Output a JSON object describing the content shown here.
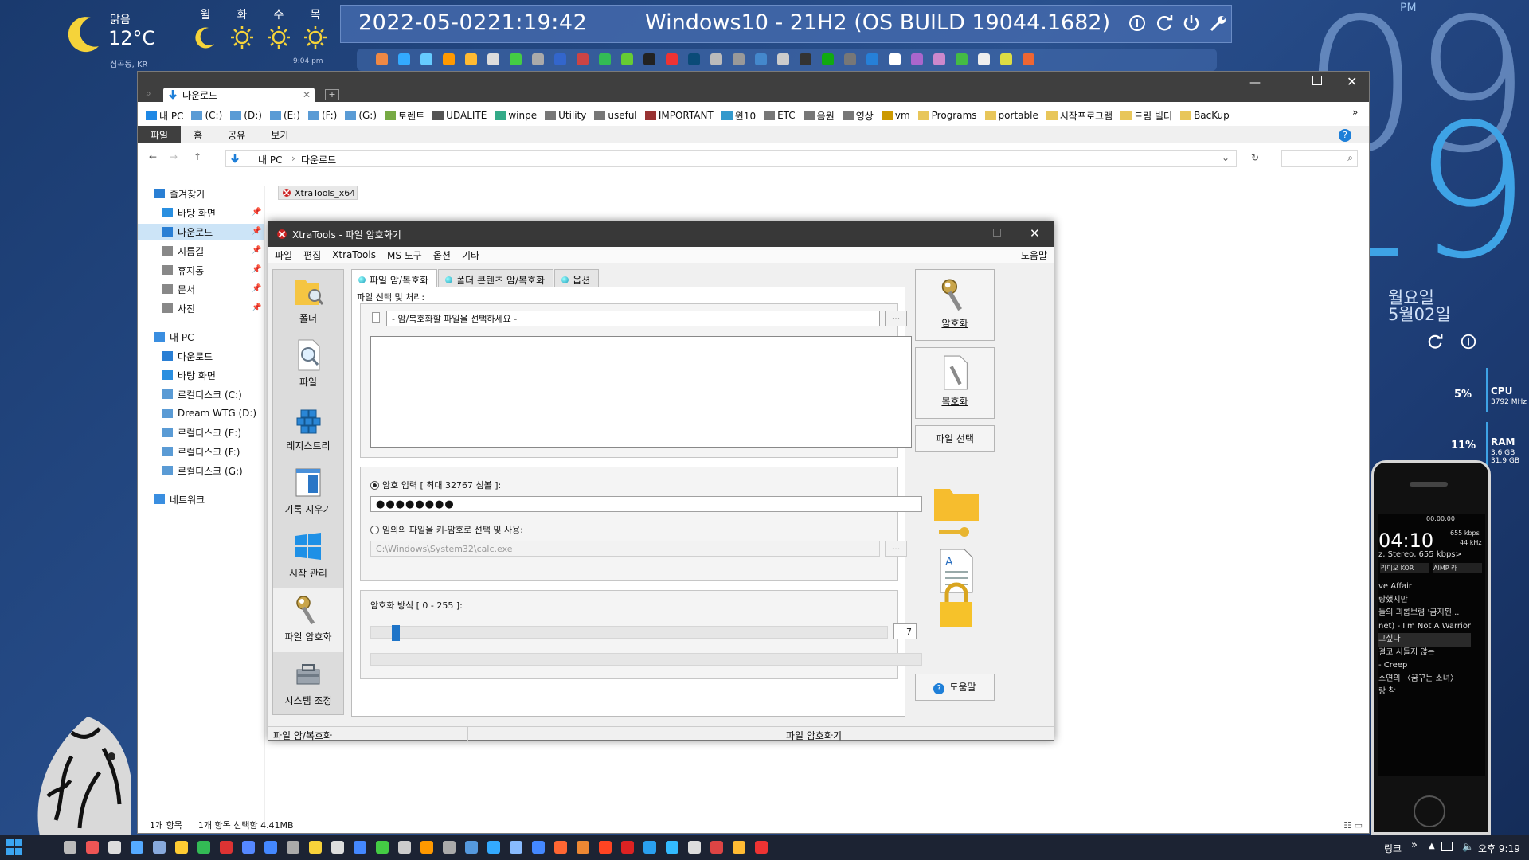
{
  "weather": {
    "condition": "맑음",
    "temp": "12°C",
    "location": "심곡동, KR",
    "time": "9:04 pm",
    "days": [
      {
        "label": "월",
        "icon": "moon-icon"
      },
      {
        "label": "화",
        "icon": "sun-icon"
      },
      {
        "label": "수",
        "icon": "sun-icon"
      },
      {
        "label": "목",
        "icon": "sun-icon"
      }
    ]
  },
  "topbar": {
    "date": "2022-05-02",
    "time": "21:19:42",
    "os": "Windows10 - 21H2 (OS BUILD 19044.1682)"
  },
  "clock": {
    "ampm": "PM",
    "hour": "09",
    "minute": "19",
    "weekday": "월요일",
    "date": "5월02일"
  },
  "stats": {
    "cpu_label": "CPU",
    "cpu_pct": "5%",
    "cpu_freq": "3792 MHz",
    "ram_label": "RAM",
    "ram_pct": "11%",
    "ram_used": "3.6 GB",
    "ram_total": "31.9 GB"
  },
  "explorer": {
    "tab_title": "다운로드",
    "favorites": [
      {
        "label": "내 PC",
        "color": "#1e88e5"
      },
      {
        "label": "(C:)",
        "color": "#5a9bd5"
      },
      {
        "label": "(D:)",
        "color": "#5a9bd5"
      },
      {
        "label": "(E:)",
        "color": "#5a9bd5"
      },
      {
        "label": "(F:)",
        "color": "#5a9bd5"
      },
      {
        "label": "(G:)",
        "color": "#5a9bd5"
      },
      {
        "label": "토렌트",
        "color": "#7a4"
      },
      {
        "label": "UDALITE",
        "color": "#555"
      },
      {
        "label": "winpe",
        "color": "#3a8"
      },
      {
        "label": "Utility",
        "color": "#777"
      },
      {
        "label": "useful",
        "color": "#777"
      },
      {
        "label": "IMPORTANT",
        "color": "#933"
      },
      {
        "label": "윈10",
        "color": "#39c"
      },
      {
        "label": "ETC",
        "color": "#777"
      },
      {
        "label": "음원",
        "color": "#777"
      },
      {
        "label": "영상",
        "color": "#777"
      },
      {
        "label": "vm",
        "color": "#c90"
      },
      {
        "label": "Programs",
        "color": "#e8c65a"
      },
      {
        "label": "portable",
        "color": "#e8c65a"
      },
      {
        "label": "시작프로그램",
        "color": "#e8c65a"
      },
      {
        "label": "드림 빌더",
        "color": "#e8c65a"
      },
      {
        "label": "BacKup",
        "color": "#e8c65a"
      }
    ],
    "ribbon_tabs": [
      "파일",
      "홈",
      "공유",
      "보기"
    ],
    "breadcrumb": [
      "내 PC",
      "다운로드"
    ],
    "search_placeholder": "",
    "nav": [
      {
        "label": "즐겨찾기",
        "indent": 0,
        "pin": false,
        "color": "#2a7fd4"
      },
      {
        "label": "바탕 화면",
        "indent": 1,
        "pin": true,
        "color": "#2a8fe0"
      },
      {
        "label": "다운로드",
        "indent": 1,
        "pin": true,
        "color": "#2a7fd4",
        "selected": true
      },
      {
        "label": "지름길",
        "indent": 1,
        "pin": true,
        "color": "#888"
      },
      {
        "label": "휴지통",
        "indent": 1,
        "pin": true,
        "color": "#888"
      },
      {
        "label": "문서",
        "indent": 1,
        "pin": true,
        "color": "#888"
      },
      {
        "label": "사진",
        "indent": 1,
        "pin": true,
        "color": "#888"
      },
      {
        "label": "내 PC",
        "indent": 0,
        "pin": false,
        "color": "#3a8ee0",
        "gap": true
      },
      {
        "label": "다운로드",
        "indent": 1,
        "pin": false,
        "color": "#2a7fd4"
      },
      {
        "label": "바탕 화면",
        "indent": 1,
        "pin": false,
        "color": "#2a8fe0"
      },
      {
        "label": "로컬디스크 (C:)",
        "indent": 1,
        "pin": false,
        "color": "#5a9bd5"
      },
      {
        "label": "Dream WTG (D:)",
        "indent": 1,
        "pin": false,
        "color": "#5a9bd5"
      },
      {
        "label": "로컬디스크 (E:)",
        "indent": 1,
        "pin": false,
        "color": "#5a9bd5"
      },
      {
        "label": "로컬디스크 (F:)",
        "indent": 1,
        "pin": false,
        "color": "#5a9bd5"
      },
      {
        "label": "로컬디스크 (G:)",
        "indent": 1,
        "pin": false,
        "color": "#5a9bd5"
      },
      {
        "label": "네트워크",
        "indent": 0,
        "pin": false,
        "color": "#3a8ee0",
        "gap": true
      }
    ],
    "file_chip": "XtraTools_x64",
    "status_count": "1개 항목",
    "status_selected": "1개 항목 선택함 4.41MB"
  },
  "dialog": {
    "title": "XtraTools - 파일 암호화기",
    "menu": [
      "파일",
      "편집",
      "XtraTools",
      "MS 도구",
      "옵션",
      "기타"
    ],
    "help_menu": "도움말",
    "left_buttons": [
      "폴더",
      "파일",
      "레지스트리",
      "기록 지우기",
      "시작 관리",
      "파일 암호화",
      "시스템 조정"
    ],
    "left_selected": 5,
    "tabs": [
      "파일 암/복호화",
      "폴더 콘텐츠 암/복호화",
      "옵션"
    ],
    "group_label": "파일 선택 및 처리:",
    "file_placeholder": "- 암/복호화할 파일을 선택하세요 -",
    "browse": "...",
    "pw_radio_label": "암호 입력 [ 최대 32767 심볼 ]:",
    "pw_value": "●●●●●●●●",
    "keyfile_radio_label": "임의의 파일을 키-암호로 선택 및 사용:",
    "keyfile_path": "C:\\Windows\\System32\\calc.exe",
    "method_label": "암호화 방식 [ 0 - 255 ]:",
    "method_value": "7",
    "method_max": 255,
    "encrypt_btn": "암호화",
    "decrypt_btn": "복호화",
    "select_file_btn": "파일 선택",
    "help_btn": "도움말",
    "status_left": "파일 암/복호화",
    "status_right": "파일 암호화기"
  },
  "player": {
    "time": "04:10",
    "elapsed": "00:00:00",
    "rate": "655 kbps",
    "khz": "44 kHz",
    "info": "z, Stereo, 655 kbps>",
    "buttons": [
      "라디오 KOR",
      "AIMP 라"
    ],
    "playlist": [
      "ve Affair",
      "랑했지만",
      "들의 괴롭보렴 '금지된...",
      "net) - I'm Not A Warrior",
      "그싶다",
      "결코 시들지 않는",
      "- Creep",
      "소연의 〈꿈꾸는 소녀〉",
      "랑 참"
    ]
  },
  "taskbar": {
    "link": "링크",
    "clock": "오후 9:19"
  }
}
